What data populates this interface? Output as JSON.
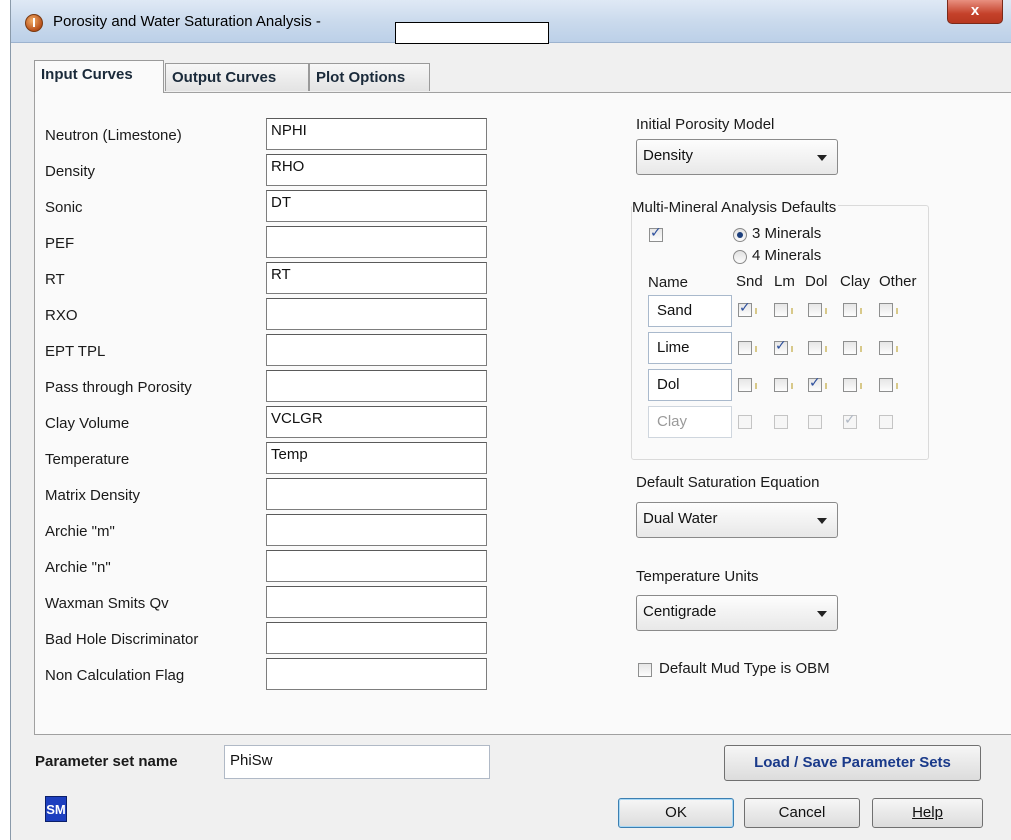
{
  "window": {
    "title": "Porosity and Water Saturation Analysis -",
    "close_label": "x"
  },
  "tabs": [
    {
      "label": "Input Curves"
    },
    {
      "label": "Output Curves"
    },
    {
      "label": "Plot Options"
    }
  ],
  "input_curves": [
    {
      "label": "Neutron (Limestone)",
      "value": "NPHI"
    },
    {
      "label": "Density",
      "value": "RHO"
    },
    {
      "label": "Sonic",
      "value": "DT"
    },
    {
      "label": "PEF",
      "value": ""
    },
    {
      "label": "RT",
      "value": "RT"
    },
    {
      "label": "RXO",
      "value": ""
    },
    {
      "label": "EPT TPL",
      "value": ""
    },
    {
      "label": "Pass through Porosity",
      "value": ""
    },
    {
      "label": "Clay Volume",
      "value": "VCLGR"
    },
    {
      "label": "Temperature",
      "value": "Temp"
    },
    {
      "label": "Matrix Density",
      "value": ""
    },
    {
      "label": "Archie \"m\"",
      "value": ""
    },
    {
      "label": "Archie \"n\"",
      "value": ""
    },
    {
      "label": "Waxman Smits Qv",
      "value": ""
    },
    {
      "label": "Bad Hole Discriminator",
      "value": ""
    },
    {
      "label": "Non Calculation Flag",
      "value": ""
    }
  ],
  "porosity_model": {
    "label": "Initial Porosity Model",
    "value": "Density"
  },
  "multi_mineral": {
    "title": "Multi-Mineral Analysis Defaults",
    "enabled": true,
    "options": [
      {
        "label": "3 Minerals",
        "selected": true
      },
      {
        "label": "4 Minerals",
        "selected": false
      }
    ],
    "name_header": "Name",
    "column_headers": [
      "Snd",
      "Lm",
      "Dol",
      "Clay",
      "Other"
    ],
    "rows": [
      {
        "name": "Sand",
        "checks": [
          true,
          false,
          false,
          false,
          false
        ],
        "disabled": false
      },
      {
        "name": "Lime",
        "checks": [
          false,
          true,
          false,
          false,
          false
        ],
        "disabled": false
      },
      {
        "name": "Dol",
        "checks": [
          false,
          false,
          true,
          false,
          false
        ],
        "disabled": false
      },
      {
        "name": "Clay",
        "checks": [
          false,
          false,
          false,
          true,
          false
        ],
        "disabled": true
      }
    ]
  },
  "saturation_equation": {
    "label": "Default Saturation Equation",
    "value": "Dual Water"
  },
  "temperature_units": {
    "label": "Temperature Units",
    "value": "Centigrade"
  },
  "mud_type": {
    "label": "Default Mud Type is OBM",
    "checked": false
  },
  "parameter_set": {
    "label": "Parameter set name",
    "value": "PhiSw"
  },
  "buttons": {
    "load_save": "Load / Save Parameter Sets",
    "ok": "OK",
    "cancel": "Cancel",
    "help": "Help"
  },
  "sm_logo": "SM",
  "colors": {
    "accent": "#1d3fbf",
    "check": "#2c4f9c",
    "close": "#c4412a"
  }
}
